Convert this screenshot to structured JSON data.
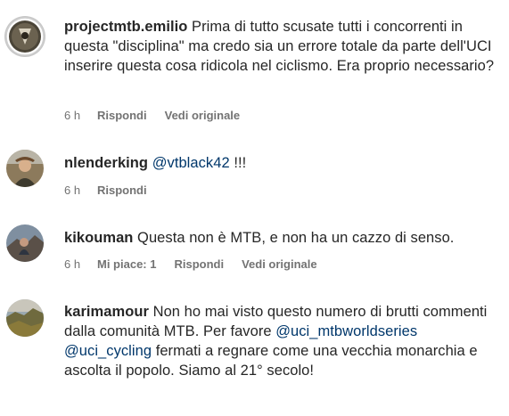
{
  "comments": [
    {
      "username": "projectmtb.emilio",
      "text": " Prima di tutto scusate tutti i concorrenti in questa \"disciplina\" ma credo sia un errore totale da parte dell'UCI inserire questa cosa ridicola nel ciclismo. Era proprio necessario?",
      "time": "6 h",
      "reply_label": "Rispondi",
      "see_original_label": "Vedi originale"
    },
    {
      "username": "nlenderking",
      "mention": "@vtblack42",
      "text": " !!!",
      "time": "6 h",
      "reply_label": "Rispondi"
    },
    {
      "username": "kikouman",
      "text": " Questa non è MTB, e non ha un cazzo di senso.",
      "time": "6 h",
      "likes_label": "Mi piace: 1",
      "reply_label": "Rispondi",
      "see_original_label": "Vedi originale"
    },
    {
      "username": "karimamour",
      "text_before": " Non ho mai visto questo numero di brutti commenti dalla comunità MTB. Per favore ",
      "mention1": "@uci_mtbworldseries",
      "text_middle": " ",
      "mention2": "@uci_cycling",
      "text_after": " fermati a regnare come una vecchia monarchia e ascolta il popolo. Siamo al 21° secolo!"
    }
  ]
}
